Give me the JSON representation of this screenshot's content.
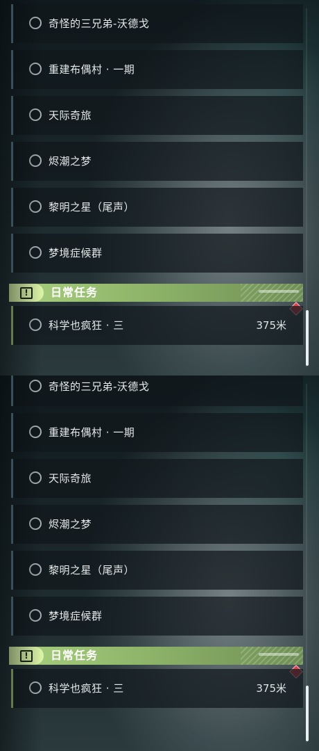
{
  "quests": [
    {
      "label": "奇怪的三兄弟-沃德戈"
    },
    {
      "label": "重建布偶村 · 一期"
    },
    {
      "label": "天际奇旅"
    },
    {
      "label": "烬潮之梦"
    },
    {
      "label": "黎明之星（尾声）"
    },
    {
      "label": "梦境症候群"
    }
  ],
  "daily_section": {
    "title": "日常任务",
    "icon": "exclamation-box-icon"
  },
  "daily_quest": {
    "label": "科学也疯狂 · 三",
    "distance": "375米"
  },
  "colors": {
    "daily_accent": "#a9cf7f",
    "quest_border": "#5a7d8a",
    "marker": "#d9434f"
  }
}
